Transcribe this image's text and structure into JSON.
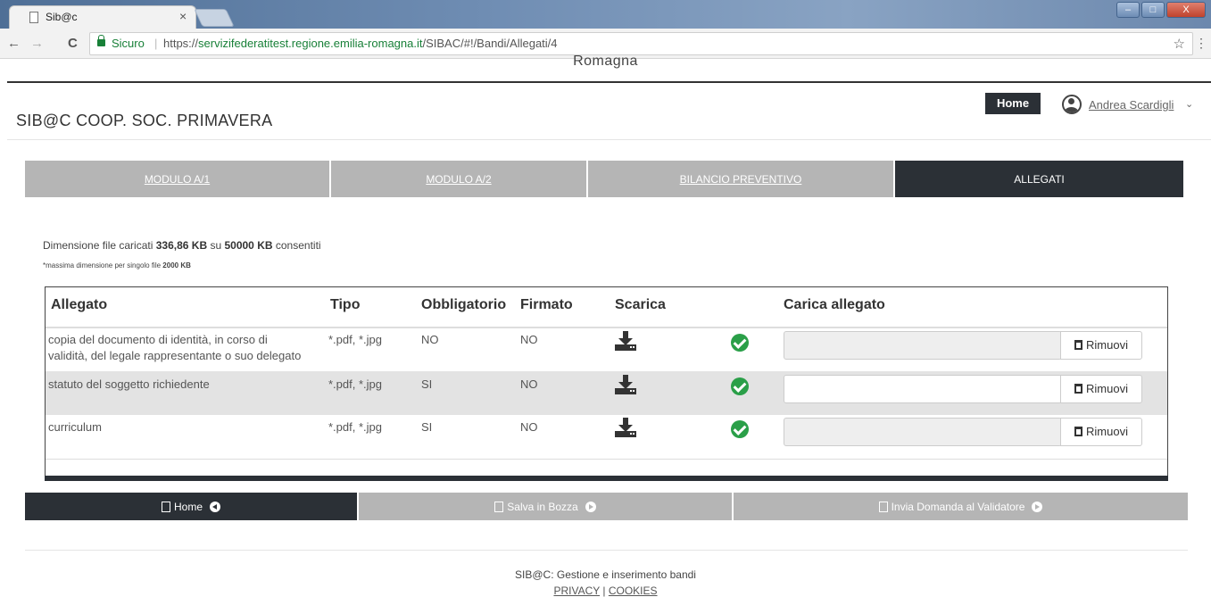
{
  "browser": {
    "tab_title": "Sib@c",
    "tab_close": "×",
    "secure_label": "Sicuro",
    "url_scheme": "https://",
    "url_host": "servizifederatitest.regione.emilia-romagna.it",
    "url_path": "/SIBAC/#!/Bandi/Allegati/4",
    "back": "←",
    "forward": "→",
    "reload": "C",
    "star": "☆",
    "menu": "⋮",
    "win_minimize": "–",
    "win_maximize": "□",
    "win_close": "X"
  },
  "header": {
    "region_title": "Romagna",
    "home_label": "Home",
    "user_name": "Andrea Scardigli",
    "user_chevron": "⌄",
    "org_name": "SIB@C COOP. SOC. PRIMAVERA"
  },
  "tabs": [
    {
      "label": "MODULO A/1",
      "active": false
    },
    {
      "label": "MODULO A/2",
      "active": false
    },
    {
      "label": "BILANCIO PREVENTIVO",
      "active": false
    },
    {
      "label": "ALLEGATI",
      "active": true
    }
  ],
  "upload_info": {
    "prefix": "Dimensione file caricati",
    "used": "336,86 KB",
    "middle": "su",
    "total": "50000 KB",
    "suffix": "consentiti",
    "max_prefix": "*massima dimensione per singolo file",
    "max_value": "2000 KB"
  },
  "table": {
    "headers": {
      "allegato": "Allegato",
      "tipo": "Tipo",
      "obbligatorio": "Obbligatorio",
      "firmato": "Firmato",
      "scarica": "Scarica",
      "carica": "Carica allegato"
    },
    "rows": [
      {
        "allegato_line1": "copia del documento di identità, in corso di",
        "allegato_line2": "validità, del legale rappresentante o suo delegato",
        "tipo": "*.pdf, *.jpg",
        "obbligatorio": "NO",
        "firmato": "NO",
        "remove_label": "Rimuovi"
      },
      {
        "allegato_line1": "statuto del soggetto richiedente",
        "allegato_line2": "",
        "tipo": "*.pdf, *.jpg",
        "obbligatorio": "SI",
        "firmato": "NO",
        "remove_label": "Rimuovi"
      },
      {
        "allegato_line1": "curriculum",
        "allegato_line2": "",
        "tipo": "*.pdf, *.jpg",
        "obbligatorio": "SI",
        "firmato": "NO",
        "remove_label": "Rimuovi"
      }
    ]
  },
  "actions": {
    "home": "Home",
    "save_draft": "Salva in Bozza",
    "submit": "Invia Domanda al Validatore"
  },
  "footer": {
    "text": "SIB@C: Gestione e inserimento bandi",
    "privacy": "PRIVACY",
    "divider": "|",
    "cookies": "COOKIES"
  },
  "colors": {
    "dark": "#2b3036",
    "tab_inactive": "#b5b5b5",
    "check_green": "#2a9f48",
    "secure_green": "#188038"
  }
}
